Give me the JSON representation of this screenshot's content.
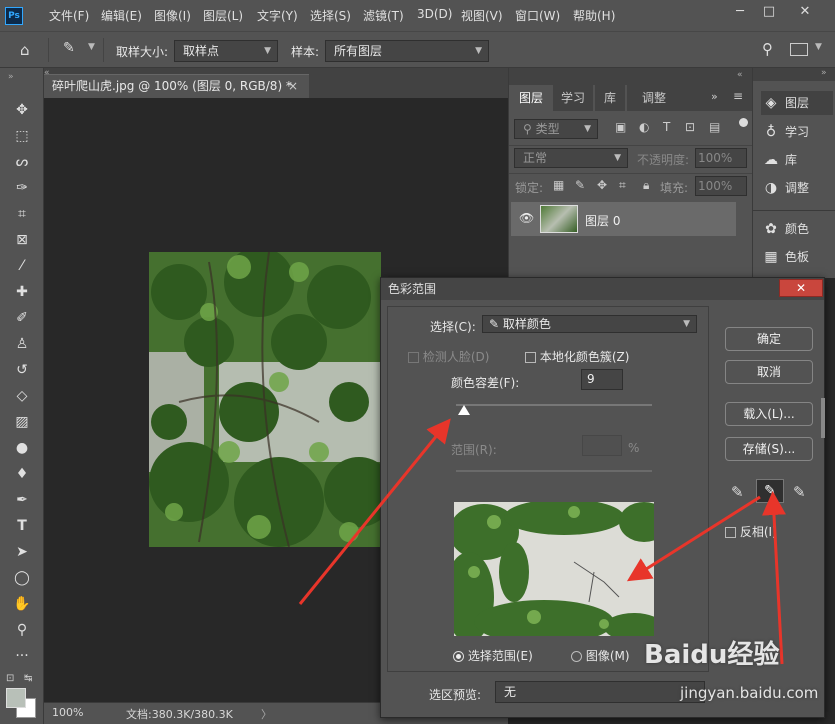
{
  "app": {
    "logo": "Ps",
    "window_controls": [
      "─",
      "□",
      "✕"
    ]
  },
  "menu": [
    "文件(F)",
    "编辑(E)",
    "图像(I)",
    "图层(L)",
    "文字(Y)",
    "选择(S)",
    "滤镜(T)",
    "3D(D)",
    "视图(V)",
    "窗口(W)",
    "帮助(H)"
  ],
  "options": {
    "sample_size_label": "取样大小:",
    "sample_size_value": "取样点",
    "sample_label": "样本:",
    "sample_value": "所有图层"
  },
  "document": {
    "tab_title": "碎叶爬山虎.jpg @ 100% (图层 0, RGB/8) *",
    "close": "×"
  },
  "status": {
    "zoom": "100%",
    "doc_info": "文档:380.3K/380.3K",
    "arrow": "〉"
  },
  "layers_panel": {
    "tabs": [
      "图层",
      "学习",
      "库",
      "调整"
    ],
    "kind_filter": "类型",
    "blend_mode": "正常",
    "opacity_label": "不透明度:",
    "opacity_value": "100%",
    "lock_label": "锁定:",
    "fill_label": "填充:",
    "fill_value": "100%",
    "layer_name": "图层 0"
  },
  "side_panels": [
    "图层",
    "学习",
    "库",
    "调整",
    "颜色",
    "色板"
  ],
  "dialog": {
    "title": "色彩范围",
    "close": "✕",
    "select_label": "选择(C):",
    "select_value": "取样颜色",
    "detect_faces": "检测人脸(D)",
    "localized_clusters": "本地化颜色簇(Z)",
    "fuzziness_label": "颜色容差(F):",
    "fuzziness_value": "9",
    "fuzziness_fraction": 0.04,
    "range_label": "范围(R):",
    "range_unit": "%",
    "radio_selection": "选择范围(E)",
    "radio_image": "图像(M)",
    "preview_label": "选区预览:",
    "preview_value": "无",
    "buttons": {
      "ok": "确定",
      "cancel": "取消",
      "load": "载入(L)...",
      "save": "存储(S)..."
    },
    "invert": "反相(I)"
  },
  "watermark": {
    "brand": "Baidu经验",
    "url": "jingyan.baidu.com"
  }
}
